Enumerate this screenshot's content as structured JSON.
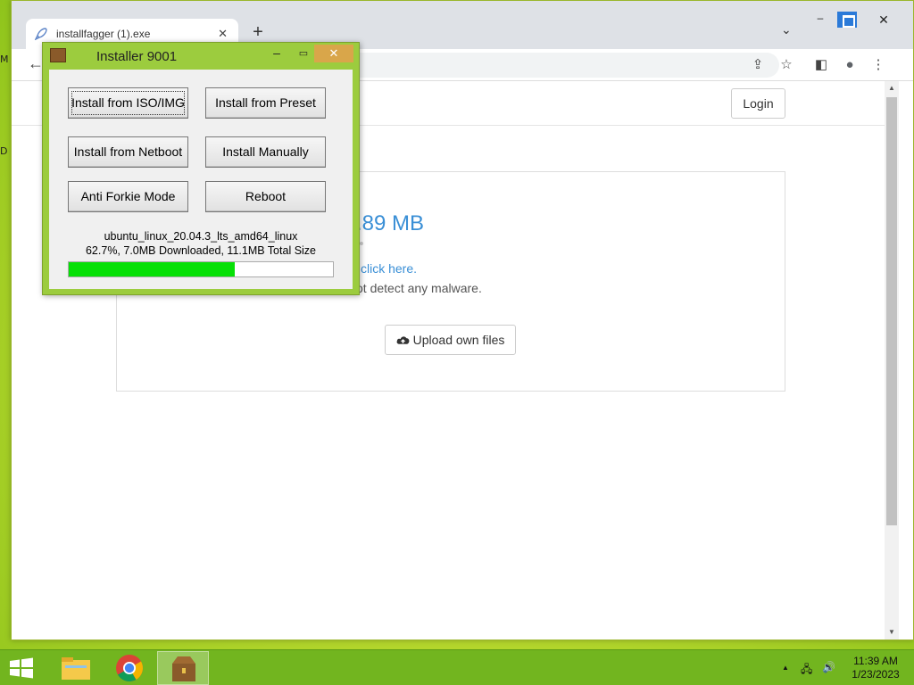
{
  "desktop": {
    "edge_labels": [
      "M",
      "D"
    ]
  },
  "browser": {
    "tab": {
      "title": "installfagger (1).exe",
      "close": "✕",
      "icon": "rocket-icon"
    },
    "new_tab": "+",
    "tab_list": "⌄",
    "window_controls": {
      "minimize": "–",
      "close": "✕"
    },
    "nav": {
      "back": "←"
    },
    "toolbar_icons": {
      "share": "⇪",
      "star": "☆",
      "side_panel": "◧",
      "profile": "●",
      "menu": "⋮"
    }
  },
  "page": {
    "login_label": "Login",
    "file_size_partial": ".89 MB",
    "link_partial": "click here.",
    "note_partial": "ot detect any malware.",
    "upload_label": "Upload own files",
    "scroll_up": "▲",
    "scroll_down": "▼"
  },
  "dialog": {
    "title": "Installer 9001",
    "controls": {
      "minimize": "–",
      "maximize": "▭",
      "close": "✕"
    },
    "buttons": {
      "iso": "Install from ISO/IMG",
      "preset": "Install from Preset",
      "netboot": "Install from Netboot",
      "manual": "Install Manually",
      "anti_forkie": "Anti Forkie Mode",
      "reboot": "Reboot"
    },
    "download_name": "ubuntu_linux_20.04.3_lts_amd64_linux",
    "download_status": "62.7%, 7.0MB Downloaded, 11.1MB Total Size",
    "progress_fraction": 0.627
  },
  "taskbar": {
    "time": "11:39 AM",
    "date": "1/23/2023",
    "tray": {
      "chevron": "▲",
      "network": "🖧",
      "volume": "🔊"
    }
  },
  "colors": {
    "accent": "#3a8fd6",
    "progress": "#06e006",
    "desktop": "#b8d82e"
  }
}
